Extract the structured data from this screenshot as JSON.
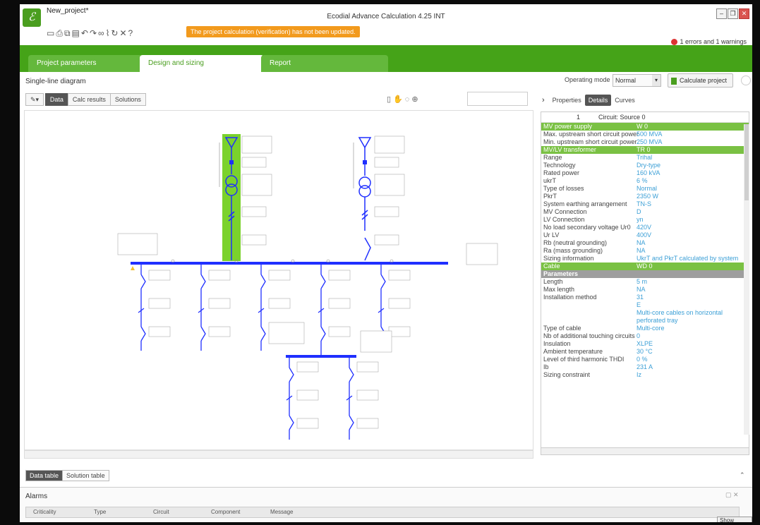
{
  "window": {
    "project_name": "New_project*",
    "app_title": "Ecodial Advance Calculation 4.25 INT",
    "warning_banner": "The project calculation (verification) has not been updated.",
    "errors": "1 errors and 1 warnings"
  },
  "tabs": [
    "Project parameters",
    "Design and sizing",
    "Report"
  ],
  "sld": {
    "title": "Single-line diagram",
    "operating_mode_label": "Operating mode",
    "operating_mode_value": "Normal",
    "calculate_label": "Calculate project",
    "view_buttons": [
      "Data",
      "Calc results",
      "Solutions"
    ]
  },
  "right_panel": {
    "tabs": [
      "Properties",
      "Details",
      "Curves"
    ],
    "header_index": "1",
    "header_title": "Circuit: Source 0",
    "rows": [
      {
        "k": "MV power supply",
        "v": "W 0",
        "style": "g"
      },
      {
        "k": "Max. upstream short circuit power",
        "v": "500 MVA",
        "style": ""
      },
      {
        "k": "Min. upstream short circuit power",
        "v": "250 MVA",
        "style": ""
      },
      {
        "k": "MV/LV transformer",
        "v": "TR 0",
        "style": "g"
      },
      {
        "k": "Range",
        "v": "Trihal",
        "style": ""
      },
      {
        "k": "Technology",
        "v": "Dry-type",
        "style": ""
      },
      {
        "k": "Rated power",
        "v": "160 kVA",
        "style": ""
      },
      {
        "k": "ukrT",
        "v": "6 %",
        "style": ""
      },
      {
        "k": "Type of losses",
        "v": "Normal",
        "style": ""
      },
      {
        "k": "PkrT",
        "v": "2350 W",
        "style": ""
      },
      {
        "k": "System earthing arrangement",
        "v": "TN-S",
        "style": ""
      },
      {
        "k": "MV Connection",
        "v": "D",
        "style": ""
      },
      {
        "k": "LV Connection",
        "v": "yn",
        "style": ""
      },
      {
        "k": "No load secondary voltage Ur0",
        "v": "420V",
        "style": ""
      },
      {
        "k": "Ur LV",
        "v": "400V",
        "style": ""
      },
      {
        "k": "Rb (neutral grounding)",
        "v": "NA",
        "style": ""
      },
      {
        "k": "Ra (mass grounding)",
        "v": "NA",
        "style": ""
      },
      {
        "k": "Sizing information",
        "v": "UkrT and PkrT calculated by system",
        "style": ""
      },
      {
        "k": "Cable",
        "v": "WD 0",
        "style": "g"
      },
      {
        "k": "Parameters",
        "v": "",
        "style": "s"
      },
      {
        "k": "Length",
        "v": "5 m",
        "style": ""
      },
      {
        "k": "Max length",
        "v": "NA",
        "style": ""
      },
      {
        "k": "Installation method",
        "v": "31",
        "style": ""
      },
      {
        "k": "",
        "v": "E",
        "style": ""
      },
      {
        "k": "",
        "v": "Multi-core cables on horizontal",
        "style": ""
      },
      {
        "k": "",
        "v": "perforated tray",
        "style": ""
      },
      {
        "k": "Type of cable",
        "v": "Multi-core",
        "style": ""
      },
      {
        "k": "Nb of additional touching circuits",
        "v": "0",
        "style": ""
      },
      {
        "k": "Insulation",
        "v": "XLPE",
        "style": ""
      },
      {
        "k": "Ambient temperature",
        "v": "30 °C",
        "style": ""
      },
      {
        "k": "Level of third harmonic THDI",
        "v": "0 %",
        "style": ""
      },
      {
        "k": "Ib",
        "v": "231 A",
        "style": ""
      },
      {
        "k": "Sizing constraint",
        "v": "Iz",
        "style": ""
      }
    ]
  },
  "bottom": {
    "tabs": [
      "Data table",
      "Solution table"
    ],
    "alarms_title": "Alarms",
    "columns": [
      "Criticality",
      "Type",
      "Circuit",
      "Component",
      "Message"
    ],
    "show_desktop": "Show desktop"
  },
  "colors": {
    "brand_green": "#45a318",
    "busbar_blue": "#1f2fff",
    "value_blue": "#3b9fd6"
  }
}
